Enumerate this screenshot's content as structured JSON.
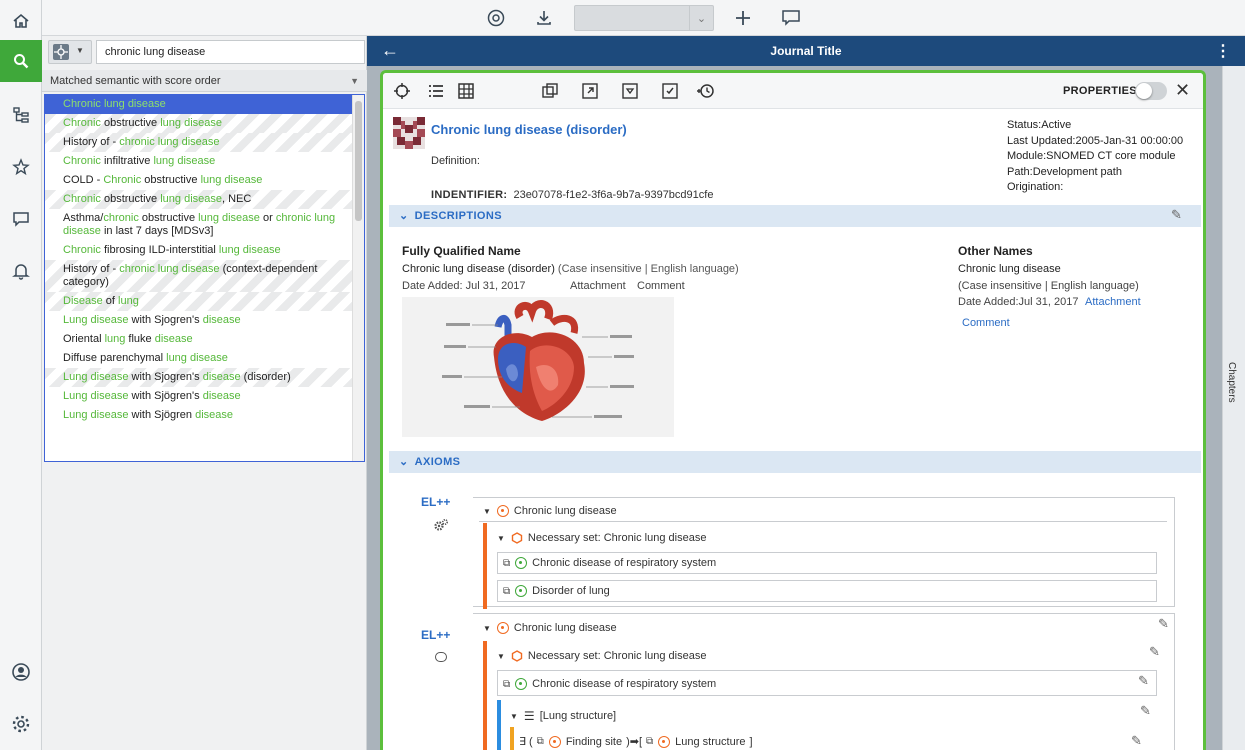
{
  "rail": {
    "items": [
      "home-icon",
      "search-icon",
      "taxonomy-icon",
      "star-icon",
      "chat-icon",
      "bell-icon",
      "account-icon",
      "settings-icon"
    ]
  },
  "toolbar": {
    "select_value": ""
  },
  "search": {
    "query": "chronic lung disease",
    "sort_mode": "Matched semantic with score order",
    "results": [
      {
        "parts": [
          [
            "Chronic lung disease",
            1
          ]
        ]
      },
      {
        "parts": [
          [
            "Chronic",
            1
          ],
          [
            " obstructive ",
            0
          ],
          [
            "lung disease",
            1
          ]
        ]
      },
      {
        "parts": [
          [
            "History of - ",
            0
          ],
          [
            "chronic lung disease",
            1
          ]
        ]
      },
      {
        "parts": [
          [
            "Chronic",
            1
          ],
          [
            " infiltrative ",
            0
          ],
          [
            "lung disease",
            1
          ]
        ]
      },
      {
        "parts": [
          [
            "COLD - ",
            0
          ],
          [
            "Chronic",
            1
          ],
          [
            " obstructive ",
            0
          ],
          [
            "lung disease",
            1
          ]
        ]
      },
      {
        "parts": [
          [
            "Chronic",
            1
          ],
          [
            " obstructive ",
            0
          ],
          [
            "lung disease",
            1
          ],
          [
            ", NEC",
            0
          ]
        ]
      },
      {
        "parts": [
          [
            "Asthma/",
            0
          ],
          [
            "chronic",
            1
          ],
          [
            " obstructive ",
            0
          ],
          [
            "lung disease",
            1
          ],
          [
            " or ",
            0
          ],
          [
            "chronic lung disease",
            1
          ],
          [
            " in last 7 days [MDSv3]",
            0
          ]
        ]
      },
      {
        "parts": [
          [
            "Chronic",
            1
          ],
          [
            " fibrosing ILD-interstitial ",
            0
          ],
          [
            "lung disease",
            1
          ]
        ]
      },
      {
        "parts": [
          [
            "History of - ",
            0
          ],
          [
            "chronic lung disease",
            1
          ],
          [
            " (context-dependent category)",
            0
          ]
        ]
      },
      {
        "parts": [
          [
            "Disease",
            1
          ],
          [
            " of ",
            0
          ],
          [
            "lung",
            1
          ]
        ]
      },
      {
        "parts": [
          [
            "Lung disease",
            1
          ],
          [
            " with Sjogren's ",
            0
          ],
          [
            "disease",
            1
          ]
        ]
      },
      {
        "parts": [
          [
            "Oriental ",
            0
          ],
          [
            "lung",
            1
          ],
          [
            " fluke ",
            0
          ],
          [
            "disease",
            1
          ]
        ]
      },
      {
        "parts": [
          [
            "Diffuse parenchymal ",
            0
          ],
          [
            "lung disease",
            1
          ]
        ]
      },
      {
        "parts": [
          [
            "Lung disease",
            1
          ],
          [
            " with Sjogren's ",
            0
          ],
          [
            "disease",
            1
          ],
          [
            " (disorder)",
            0
          ]
        ]
      },
      {
        "parts": [
          [
            "Lung disease",
            1
          ],
          [
            " with Sjögren's ",
            0
          ],
          [
            "disease",
            1
          ]
        ]
      },
      {
        "parts": [
          [
            "Lung disease",
            1
          ],
          [
            " with Sjögren ",
            0
          ],
          [
            "disease",
            1
          ]
        ]
      }
    ]
  },
  "journal": {
    "title": "Journal Title",
    "chapters_label": "Chapters"
  },
  "card": {
    "properties_label": "PROPERTIES",
    "concept_name": "Chronic lung disease (disorder)",
    "definition_label": "Definition:",
    "identifier_label": "INDENTIFIER:",
    "identifier_value": "23e07078-f1e2-3f6a-9b7a-9397bcd91cfe",
    "meta": [
      [
        "Status:",
        "Active"
      ],
      [
        "Last Updated:",
        "2005-Jan-31 00:00:00"
      ],
      [
        "Module:",
        "SNOMED CT core module"
      ],
      [
        "Path:",
        "Development path"
      ],
      [
        "Origination:",
        ""
      ]
    ],
    "descriptions_label": "DESCRIPTIONS",
    "fqn_heading": "Fully Qualified Name",
    "fqn_value": "Chronic lung disease (disorder)",
    "fqn_flags": "(Case insensitive | English language)",
    "fqn_date_added": "Date Added:   Jul 31, 2017",
    "fqn_attachment": "Attachment",
    "fqn_comment": "Comment",
    "other_heading": "Other Names",
    "other_value": "Chronic lung disease",
    "other_flags": "(Case insensitive | English language)",
    "other_date_added": "Date Added:Jul 31, 2017",
    "other_attachment": "Attachment",
    "other_comment": "Comment",
    "axioms_label": "AXIOMS",
    "el_label_1": "EL++",
    "el_label_2": "EL++",
    "axiom1": {
      "root": "Chronic lung disease",
      "set": "Necessary set: Chronic lung disease",
      "items": [
        "Chronic disease of respiratory system",
        "Disorder of lung"
      ]
    },
    "axiom2": {
      "root": "Chronic lung disease",
      "set": "Necessary set: Chronic lung disease",
      "items": [
        "Chronic disease of respiratory system"
      ],
      "group": "[Lung structure]",
      "role_prefix": "∃ (",
      "role": "Finding site",
      "role_arrow": ")➡[",
      "role_target": "Lung structure",
      "role_suffix": "]"
    }
  }
}
